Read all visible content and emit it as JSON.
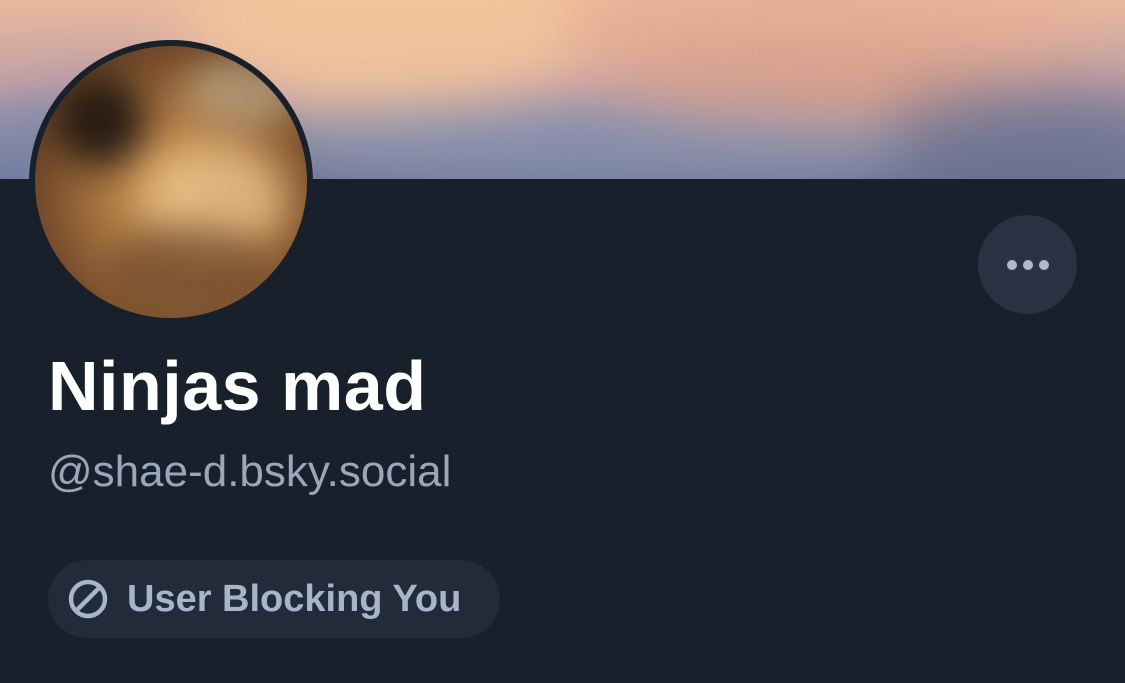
{
  "profile": {
    "display_name": "Ninjas mad",
    "handle": "@shae-d.bsky.social",
    "block_status": "User Blocking You"
  },
  "icons": {
    "more": "ellipsis-icon",
    "block": "block-icon"
  },
  "colors": {
    "background": "#18202b",
    "button_bg": "#283242",
    "badge_bg": "#222b3a",
    "muted_text": "#9aa7ba"
  }
}
